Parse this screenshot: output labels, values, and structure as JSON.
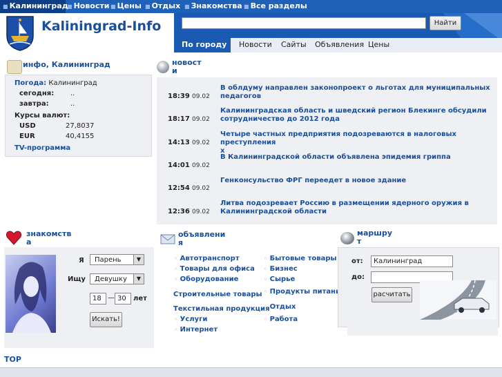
{
  "topnav": {
    "items": [
      "Калининград",
      "Новости",
      "Цены",
      "Отдых",
      "Знакомства",
      "Все разделы"
    ]
  },
  "header": {
    "logo_text": "Kaliningrad-Info",
    "search_button": "Найти",
    "search_value": ""
  },
  "subnav": {
    "active": "По городу",
    "items": [
      "Новости",
      "Сайты",
      "Объявления",
      "Цены"
    ]
  },
  "info": {
    "title": "инфо, Калининград",
    "weather_label": "Погода:",
    "weather_city": "Калининград",
    "today_label": "сегодня:",
    "today_value": "..",
    "tomorrow_label": "завтра:",
    "tomorrow_value": "..",
    "rates_label": "Курсы валют:",
    "rates": [
      {
        "currency": "USD",
        "value": "27,8037"
      },
      {
        "currency": "EUR",
        "value": "40,4155"
      }
    ],
    "tv_link": "TV-программа"
  },
  "news": {
    "title_line1": "новост",
    "title_line2": "и",
    "items": [
      {
        "time": "18:39",
        "date": "09.02",
        "text_line1": "В облдуму направлен законопроект о льготах для муниципальных",
        "text_line2": "педагогов"
      },
      {
        "time": "18:17",
        "date": "09.02",
        "text_line1": "Калининградская область и шведский регион Блекинге обсудили",
        "text_line2": "сотрудничество до 2012 года"
      },
      {
        "time": "14:13",
        "date": "09.02",
        "text_line1": "Четыре частных предприятия подозреваются в налоговых преступления",
        "text_line2": "х"
      },
      {
        "time": "14:01",
        "date": "09.02",
        "text_line1": "В Калининградской области объявлена эпидемия гриппа",
        "text_line2": ""
      },
      {
        "time": "12:54",
        "date": "09.02",
        "text_line1": "Генконсульство ФРГ переедет в новое здание",
        "text_line2": ""
      },
      {
        "time": "12:36",
        "date": "09.02",
        "text_line1": "Литва подозревает Россию в размещении ядерного оружия в",
        "text_line2": "Калининградской области"
      }
    ]
  },
  "dating": {
    "title_line1": "знакомств",
    "title_line2": "а",
    "i_label": "Я",
    "i_value": "Парень",
    "seek_label": "Ищу",
    "seek_value": "Девушку",
    "age_from": "18",
    "age_dash": "—",
    "age_to": "30",
    "age_unit": "лет",
    "search_button": "Искать!"
  },
  "ads": {
    "title_line1": "объявлени",
    "title_line2": "я",
    "col1": [
      "Автотранспорт",
      "Товары для офиса",
      "Оборудование",
      "Строительные товары",
      "Текстильная продукция",
      "Услуги",
      "Интернет"
    ],
    "col2": [
      "Бытовые товары",
      "Бизнес",
      "Сырье",
      "Продукты питания",
      "Отдых",
      "Работа"
    ]
  },
  "route": {
    "title_line1": "маршру",
    "title_line2": "т",
    "from_label": "от:",
    "from_value": "Калининград",
    "to_label": "до:",
    "to_value": "",
    "button": "расчитать"
  },
  "footer": {
    "top_link": "TOP"
  },
  "colors": {
    "brand_blue": "#1f60b8",
    "link_blue": "#1a4f9c",
    "panel_bg": "#eef0f3"
  }
}
